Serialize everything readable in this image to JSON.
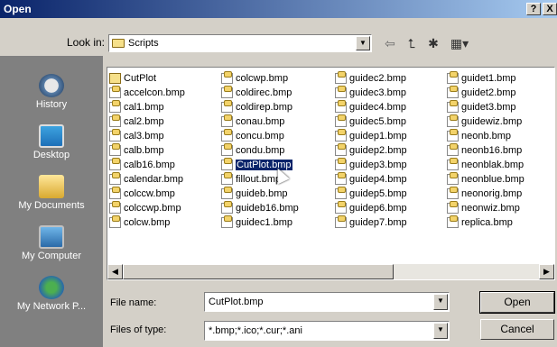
{
  "window": {
    "title": "Open",
    "help_label": "?",
    "close_label": "X"
  },
  "lookin": {
    "label": "Look in:",
    "value": "Scripts"
  },
  "toolbar": {
    "back_icon": "back-arrow-icon",
    "up_icon": "up-folder-icon",
    "new_folder_icon": "new-folder-icon",
    "view_icon": "view-menu-icon"
  },
  "places": [
    {
      "label": "History"
    },
    {
      "label": "Desktop"
    },
    {
      "label": "My Documents"
    },
    {
      "label": "My Computer"
    },
    {
      "label": "My Network P..."
    }
  ],
  "files": {
    "col0": [
      {
        "name": "CutPlot",
        "type": "folder"
      },
      {
        "name": "accelcon.bmp",
        "type": "bmp"
      },
      {
        "name": "cal1.bmp",
        "type": "bmp"
      },
      {
        "name": "cal2.bmp",
        "type": "bmp"
      },
      {
        "name": "cal3.bmp",
        "type": "bmp"
      },
      {
        "name": "calb.bmp",
        "type": "bmp"
      },
      {
        "name": "calb16.bmp",
        "type": "bmp"
      },
      {
        "name": "calendar.bmp",
        "type": "bmp"
      },
      {
        "name": "colccw.bmp",
        "type": "bmp"
      },
      {
        "name": "colccwp.bmp",
        "type": "bmp"
      },
      {
        "name": "colcw.bmp",
        "type": "bmp"
      }
    ],
    "col1": [
      {
        "name": "colcwp.bmp",
        "type": "bmp"
      },
      {
        "name": "coldirec.bmp",
        "type": "bmp"
      },
      {
        "name": "coldirep.bmp",
        "type": "bmp"
      },
      {
        "name": "conau.bmp",
        "type": "bmp"
      },
      {
        "name": "concu.bmp",
        "type": "bmp"
      },
      {
        "name": "condu.bmp",
        "type": "bmp"
      },
      {
        "name": "CutPlot.bmp",
        "type": "bmp",
        "selected": true
      },
      {
        "name": "fillout.bmp",
        "type": "bmp"
      },
      {
        "name": "guideb.bmp",
        "type": "bmp"
      },
      {
        "name": "guideb16.bmp",
        "type": "bmp"
      },
      {
        "name": "guidec1.bmp",
        "type": "bmp"
      }
    ],
    "col2": [
      {
        "name": "guidec2.bmp",
        "type": "bmp"
      },
      {
        "name": "guidec3.bmp",
        "type": "bmp"
      },
      {
        "name": "guidec4.bmp",
        "type": "bmp"
      },
      {
        "name": "guidec5.bmp",
        "type": "bmp"
      },
      {
        "name": "guidep1.bmp",
        "type": "bmp"
      },
      {
        "name": "guidep2.bmp",
        "type": "bmp"
      },
      {
        "name": "guidep3.bmp",
        "type": "bmp"
      },
      {
        "name": "guidep4.bmp",
        "type": "bmp"
      },
      {
        "name": "guidep5.bmp",
        "type": "bmp"
      },
      {
        "name": "guidep6.bmp",
        "type": "bmp"
      },
      {
        "name": "guidep7.bmp",
        "type": "bmp"
      }
    ],
    "col3": [
      {
        "name": "guidet1.bmp",
        "type": "bmp"
      },
      {
        "name": "guidet2.bmp",
        "type": "bmp"
      },
      {
        "name": "guidet3.bmp",
        "type": "bmp"
      },
      {
        "name": "guidewiz.bmp",
        "type": "bmp"
      },
      {
        "name": "neonb.bmp",
        "type": "bmp"
      },
      {
        "name": "neonb16.bmp",
        "type": "bmp"
      },
      {
        "name": "neonblak.bmp",
        "type": "bmp"
      },
      {
        "name": "neonblue.bmp",
        "type": "bmp"
      },
      {
        "name": "neonorig.bmp",
        "type": "bmp"
      },
      {
        "name": "neonwiz.bmp",
        "type": "bmp"
      },
      {
        "name": "replica.bmp",
        "type": "bmp"
      }
    ]
  },
  "filename": {
    "label": "File name:",
    "value": "CutPlot.bmp"
  },
  "filetype": {
    "label": "Files of type:",
    "value": "*.bmp;*.ico;*.cur;*.ani"
  },
  "buttons": {
    "open": "Open",
    "cancel": "Cancel"
  },
  "colors": {
    "title_start": "#0a246a",
    "title_end": "#a6caf0",
    "selection": "#0a246a",
    "face": "#d4d0c8",
    "places_bg": "#808080"
  }
}
